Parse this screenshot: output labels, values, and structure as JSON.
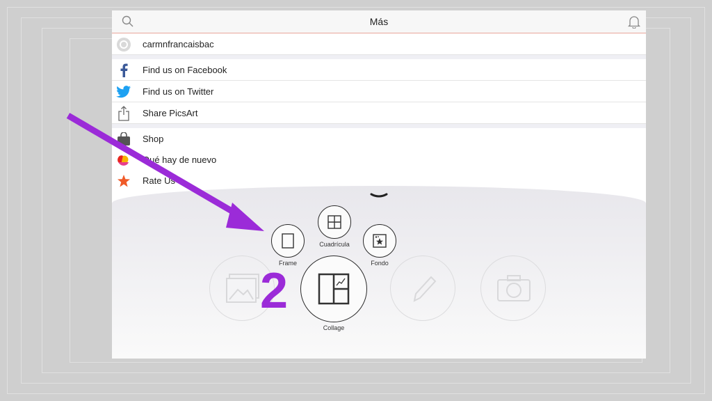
{
  "header": {
    "title": "Más"
  },
  "menu": {
    "user": "carmnfrancaisbac",
    "social": [
      "Find us on Facebook",
      "Find us on Twitter",
      "Share PicsArt"
    ],
    "more": [
      "Shop",
      "Qué hay de nuevo",
      "Rate Us"
    ]
  },
  "creation_menu": {
    "frame": "Frame",
    "grid": "Cuadrícula",
    "background": "Fondo",
    "collage": "Collage"
  },
  "annotation": {
    "step_number": "2",
    "arrow_color": "#9b2bd8"
  },
  "colors": {
    "accent_line": "#e9a59a",
    "facebook": "#3b5998",
    "twitter": "#1da1f2",
    "star": "#f05a28"
  }
}
